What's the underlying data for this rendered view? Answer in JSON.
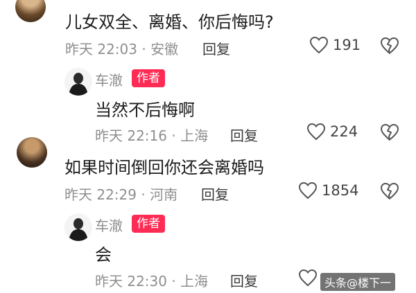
{
  "comments": [
    {
      "text": "儿女双全、离婚、你后悔吗?",
      "meta": "昨天 22:03 · 安徽",
      "reply_label": "回复",
      "likes": "191"
    },
    {
      "author": "车澈",
      "badge": "作者",
      "text": "当然不后悔啊",
      "meta": "昨天 22:16 · 上海",
      "reply_label": "回复",
      "likes": "224"
    },
    {
      "text": "如果时间倒回你还会离婚吗",
      "meta": "昨天 22:29 · 河南",
      "reply_label": "回复",
      "likes": "1854"
    },
    {
      "author": "车澈",
      "badge": "作者",
      "text": "会",
      "meta": "昨天 22:30 · 上海",
      "reply_label": "回复"
    }
  ],
  "watermark": "头条@楼下一",
  "colors": {
    "badge": "#fe2c55",
    "meta": "#8e8e8e",
    "icon": "#555555"
  },
  "icons": {
    "like": "heart-outline-icon",
    "dislike": "broken-heart-icon"
  }
}
